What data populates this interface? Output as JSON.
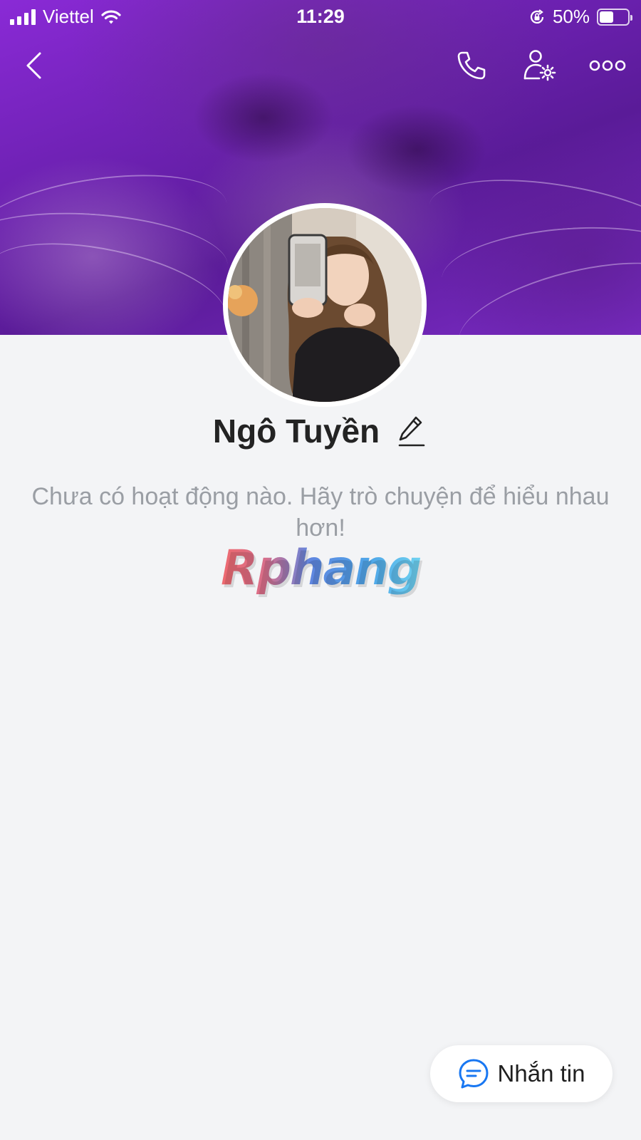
{
  "status_bar": {
    "carrier": "Viettel",
    "time": "11:29",
    "battery": "50%",
    "battery_level": 0.5
  },
  "nav": {
    "icons": [
      "back-icon",
      "phone-icon",
      "user-settings-icon",
      "more-icon"
    ]
  },
  "profile": {
    "name": "Ngô Tuyền",
    "empty_message": "Chưa có hoạt động nào. Hãy trò chuyện để hiểu nhau hơn!"
  },
  "watermark": {
    "text": "Rphang"
  },
  "actions": {
    "message_label": "Nhắn tin"
  },
  "colors": {
    "cover_accent": "#7a2bc4",
    "page_background": "#f3f4f6",
    "message_icon": "#1877f2"
  }
}
